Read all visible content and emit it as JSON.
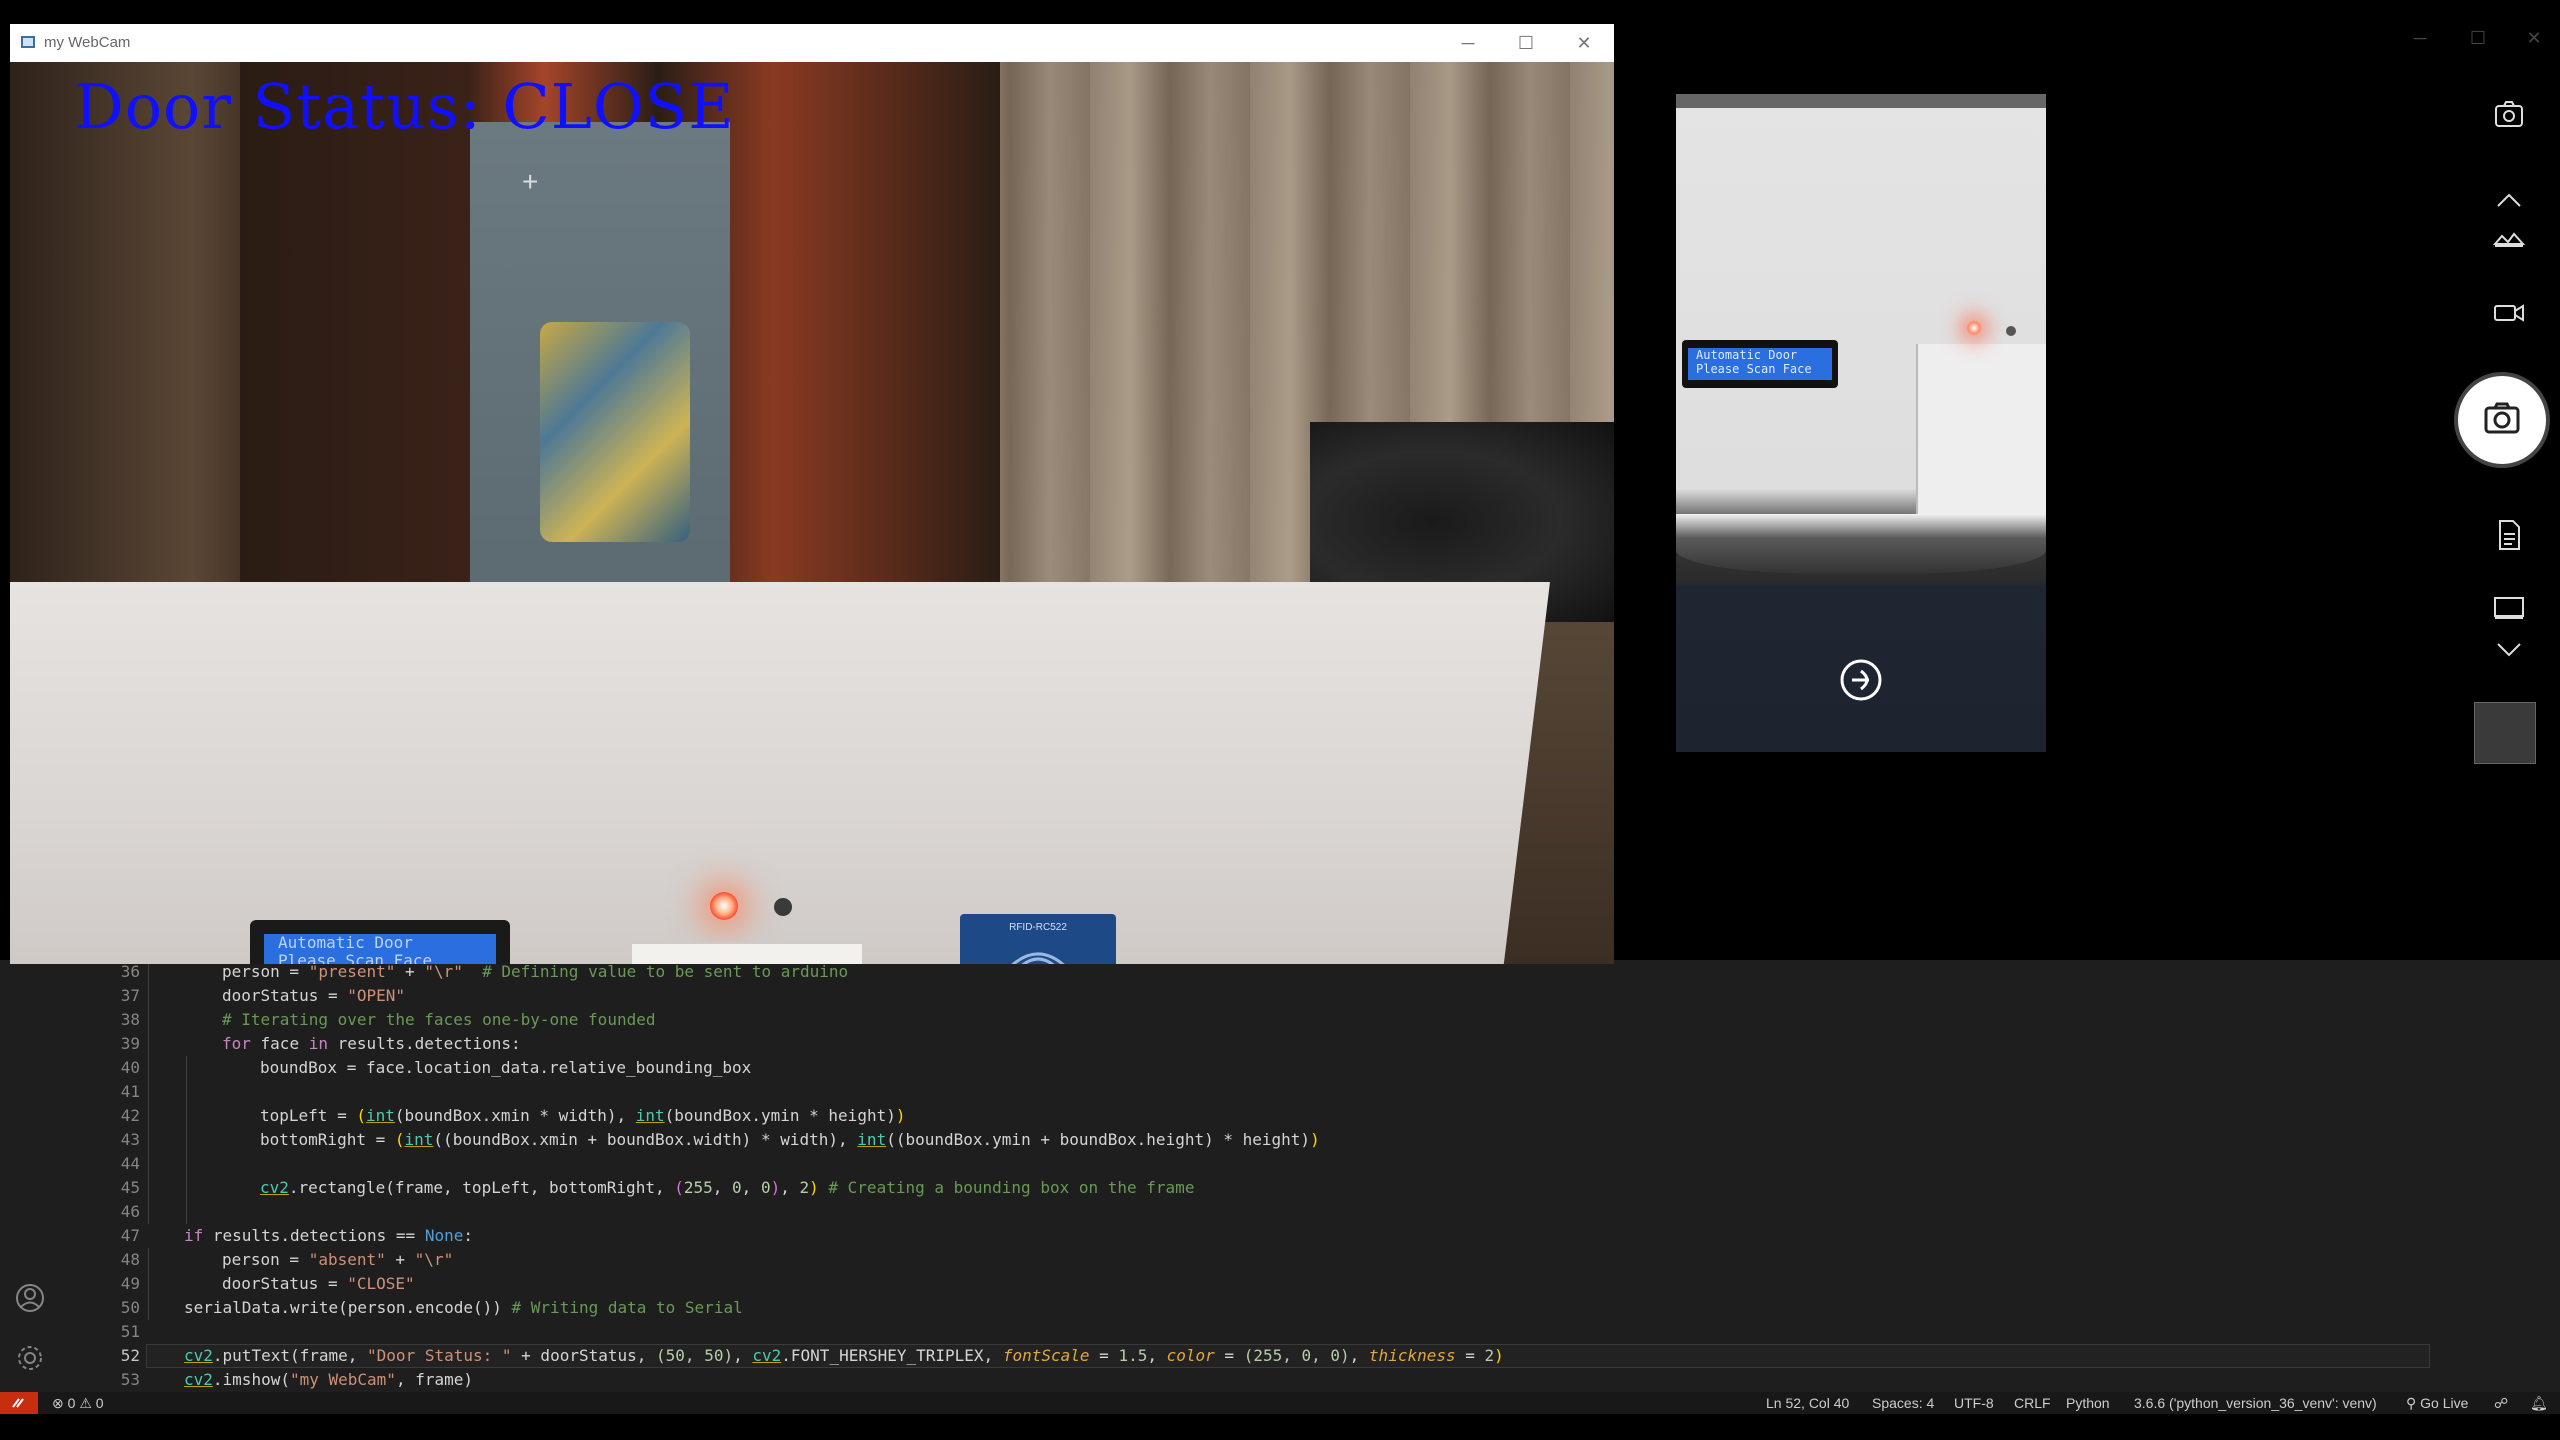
{
  "webcam_window": {
    "title": "my WebCam",
    "overlay_text": "Door Status: CLOSE",
    "lcd_text_line1": "Automatic Door",
    "lcd_text_line2": "Please Scan Face",
    "rfid_label": "RFID-RC522"
  },
  "camera_app": {
    "lcd_line1": "Automatic Door",
    "lcd_line2": "Please Scan Face"
  },
  "editor": {
    "lines": [
      {
        "n": "36"
      },
      {
        "n": "37"
      },
      {
        "n": "38"
      },
      {
        "n": "39"
      },
      {
        "n": "40"
      },
      {
        "n": "41"
      },
      {
        "n": "42"
      },
      {
        "n": "43"
      },
      {
        "n": "44"
      },
      {
        "n": "45"
      },
      {
        "n": "46"
      },
      {
        "n": "47"
      },
      {
        "n": "48"
      },
      {
        "n": "49"
      },
      {
        "n": "50"
      },
      {
        "n": "51"
      },
      {
        "n": "52"
      },
      {
        "n": "53"
      }
    ],
    "code": {
      "l36_a": "person",
      "l36_b": " = ",
      "l36_c": "\"present\"",
      "l36_d": " + ",
      "l36_e": "\"\\r\"",
      "l36_f": "  # Defining value to be sent to arduino",
      "l37_a": "doorStatus",
      "l37_b": " = ",
      "l37_c": "\"OPEN\"",
      "l38_a": "# Iterating over the faces one-by-one founded",
      "l39_a": "for",
      "l39_b": " face ",
      "l39_c": "in",
      "l39_d": " results.detections:",
      "l40_a": "boundBox",
      "l40_b": " = face.location_data.relative_bounding_box",
      "l42_a": "topLeft",
      "l42_b": " = ",
      "l42_c": "(",
      "l42_d": "int",
      "l42_e": "(boundBox.xmin ",
      "l42_f": "*",
      "l42_g": " width), ",
      "l42_h": "int",
      "l42_i": "(boundBox.ymin ",
      "l42_j": "*",
      "l42_k": " height)",
      "l42_l": ")",
      "l43_a": "bottomRight",
      "l43_b": " = ",
      "l43_c": "(",
      "l43_d": "int",
      "l43_e": "((boundBox.xmin ",
      "l43_f": "+",
      "l43_g": " boundBox.width) ",
      "l43_h": "*",
      "l43_i": " width), ",
      "l43_j": "int",
      "l43_k": "((boundBox.ymin ",
      "l43_l": "+",
      "l43_m": " boundBox.height) ",
      "l43_n": "*",
      "l43_o": " height)",
      "l43_p": ")",
      "l45_a": "cv2",
      "l45_b": ".rectangle(frame, topLeft, bottomRight, ",
      "l45_c": "(",
      "l45_d": "255",
      "l45_e": ", ",
      "l45_f": "0",
      "l45_g": ", ",
      "l45_h": "0",
      "l45_i": ")",
      "l45_j": ", ",
      "l45_k": "2",
      "l45_l": ")",
      "l45_m": " # Creating a bounding box on the frame",
      "l47_a": "if",
      "l47_b": " results.detections ",
      "l47_c": "==",
      "l47_d": " None",
      "l47_e": ":",
      "l48_a": "person",
      "l48_b": " = ",
      "l48_c": "\"absent\"",
      "l48_d": " + ",
      "l48_e": "\"\\r\"",
      "l49_a": "doorStatus",
      "l49_b": " = ",
      "l49_c": "\"CLOSE\"",
      "l50_a": "serialData.write(person.encode())",
      "l50_b": " # Writing data to Serial",
      "l52_a": "cv2",
      "l52_b": ".putText(frame, ",
      "l52_c": "\"Door Status: \"",
      "l52_d": " + doorStatus, ",
      "l52_e": "(50, 50)",
      "l52_f": ", ",
      "l52_g": "cv2",
      "l52_h": ".FONT_HERSHEY_TRIPLEX, ",
      "l52_i": "fontScale",
      "l52_j": " = ",
      "l52_k": "1.5",
      "l52_l": ", ",
      "l52_m": "color",
      "l52_n": " = ",
      "l52_o": "(255, 0, 0)",
      "l52_p": ", ",
      "l52_q": "thickness",
      "l52_r": " = ",
      "l52_s": "2",
      "l52_t": ")",
      "l53_a": "cv2",
      "l53_b": ".imshow(",
      "l53_c": "\"my WebCam\"",
      "l53_d": ", frame)"
    }
  },
  "statusbar": {
    "errors": "0",
    "warnings": "0",
    "position": "Ln 52, Col 40",
    "spaces": "Spaces: 4",
    "encoding": "UTF-8",
    "eol": "CRLF",
    "language": "Python",
    "interpreter": "3.6.6 ('python_version_36_venv': venv)",
    "golive": "Go Live"
  },
  "colors": {
    "accent_remote": "#c72e0f",
    "overlay_text": "#1010ff",
    "editor_bg": "#1e1e1e"
  },
  "icons": {
    "camera_switch": "camera-switch-icon",
    "chevron_up": "chevron-up-icon",
    "hdr": "hdr-icon",
    "video": "video-icon",
    "photo": "photo-icon",
    "document": "document-scan-icon",
    "whiteboard": "whiteboard-icon",
    "chevron_down": "chevron-down-icon",
    "account": "account-icon",
    "settings": "gear-icon",
    "bell": "bell-icon"
  }
}
